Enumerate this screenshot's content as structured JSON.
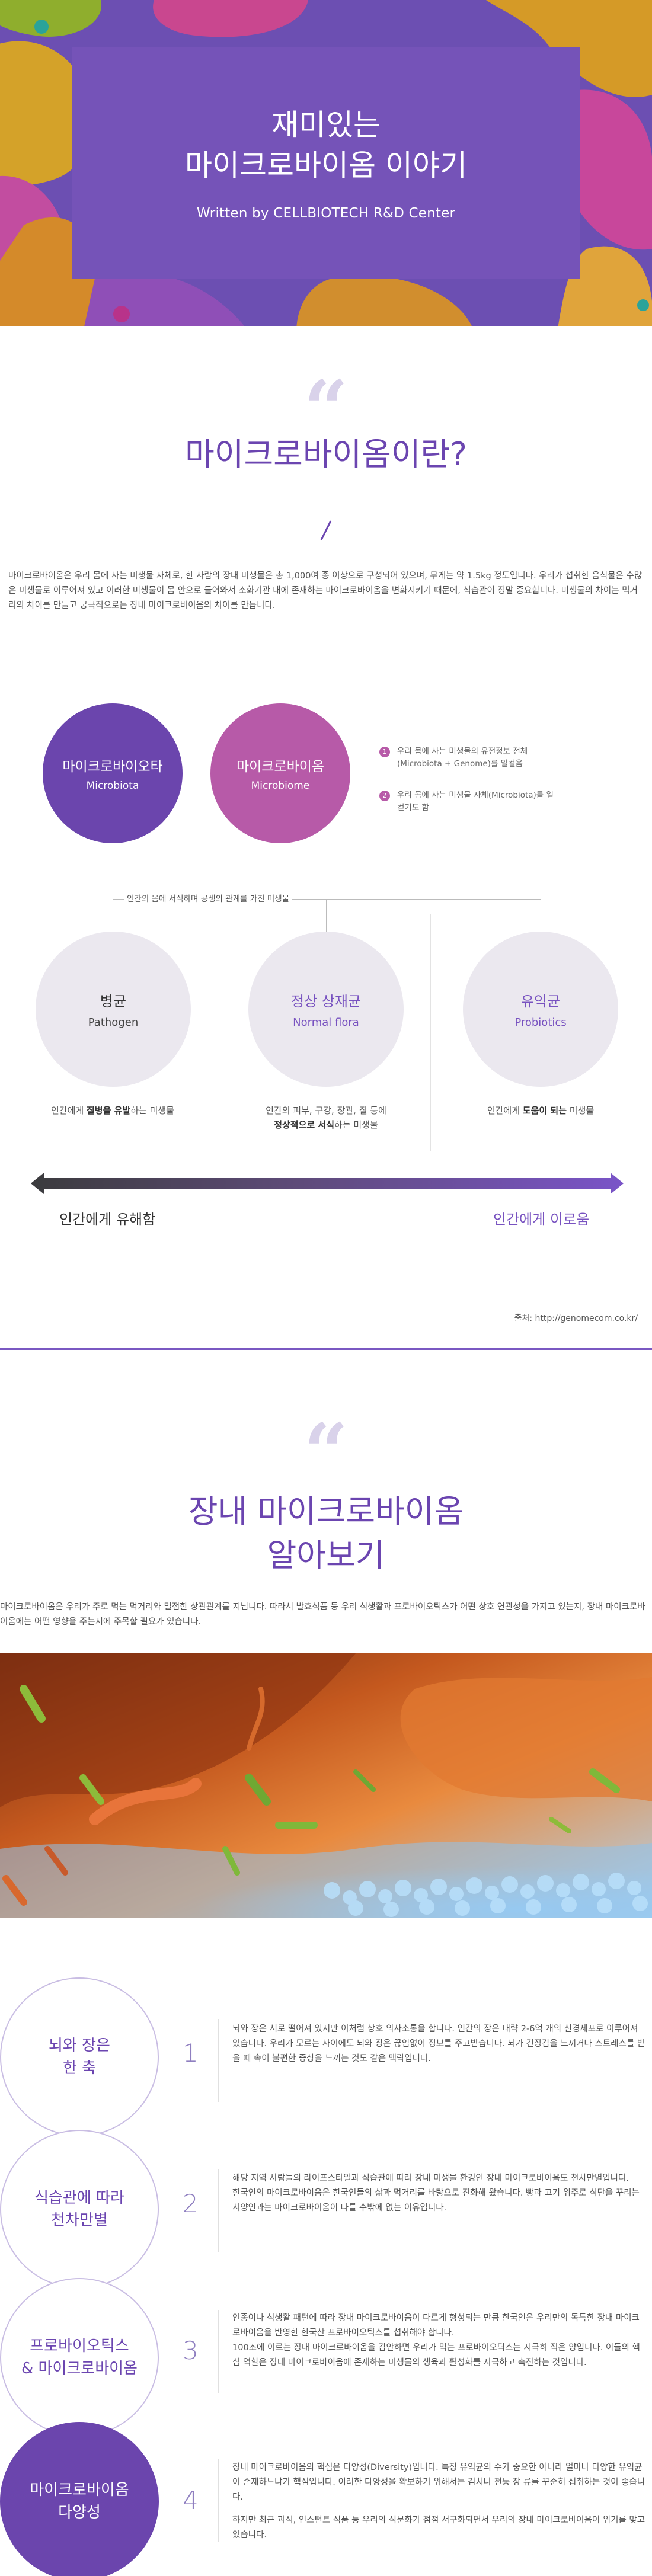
{
  "hero": {
    "title_line1": "재미있는",
    "title_line2": "마이크로바이옴 이야기",
    "subtitle": "Written by CELLBIOTECH R&D Center"
  },
  "section1": {
    "quote_mark": "“",
    "title": "마이크로바이옴이란?",
    "paragraph": "마이크로바이옴은 우리 몸에 사는 미생물 자체로, 한 사람의 장내 미생물은 총 1,000여 종 이상으로 구성되어 있으며, 무게는 약 1.5kg 정도입니다. 우리가 섭취한 음식물은 수많은 미생물로 이루어져 있고 이러한 미생물이 몸 안으로 들어와서 소화기관 내에 존재하는 마이크로바이옴을 변화시키기 때문에, 식습관이 정말 중요합니다. 미생물의 차이는 먹거리의 차이를 만들고 궁극적으로는 장내 마이크로바이옴의 차이를 만듭니다."
  },
  "diagram": {
    "microbiota": {
      "kr": "마이크로바이오타",
      "en": "Microbiota"
    },
    "microbiome": {
      "kr": "마이크로바이옴",
      "en": "Microbiome"
    },
    "notes": [
      {
        "num": "1",
        "text": "우리 몸에 사는 미생물의 유전정보 전체 (Microbiota + Genome)를 일컬음"
      },
      {
        "num": "2",
        "text": "우리 몸에 사는 미생물 자체(Microbiota)를 일컫기도 함"
      }
    ],
    "branch_label": "인간의 몸에 서식하며 공생의 관계를 가진 미생물",
    "pathogen": {
      "kr": "병균",
      "en": "Pathogen"
    },
    "normal": {
      "kr": "정상 상재균",
      "en": "Normal flora"
    },
    "probiotics": {
      "kr": "유익균",
      "en": "Probiotics"
    },
    "cap_pathogen_pre": "인간에게 ",
    "cap_pathogen_bold": "질병을 유발",
    "cap_pathogen_post": "하는 미생물",
    "cap_normal_line1": "인간의 피부, 구강, 장관, 질 등에",
    "cap_normal_bold": "정상적으로 서식",
    "cap_normal_post": "하는 미생물",
    "cap_pro_pre": "인간에게 ",
    "cap_pro_bold": "도움이 되는",
    "cap_pro_post": " 미생물",
    "left_label": "인간에게 유해함",
    "right_label": "인간에게 이로움",
    "source": "출처: http://genomecom.co.kr/",
    "colors": {
      "dark": "#3a3a3a",
      "purple": "#7852c0"
    }
  },
  "section2": {
    "quote_mark": "“",
    "title_line1": "장내 마이크로바이옴",
    "title_line2": "알아보기",
    "paragraph": "마이크로바이옴은 우리가 주로 먹는 먹거리와 밀접한 상관관계를 지닙니다. 따라서 발효식품 등 우리 식생활과 프로바이오틱스가 어떤 상호 연관성을 가지고 있는지, 장내 마이크로바이옴에는 어떤 영향을 주는지에 주목할 필요가 있습니다."
  },
  "items": [
    {
      "label_line1": "뇌와 장은",
      "label_line2": "한 축",
      "num": "1",
      "text": "뇌와 장은 서로 떨어져 있지만 이처럼 상호 의사소통을 합니다. 인간의 장은 대략 2-6억 개의 신경세포로 이루어져 있습니다. 우리가 모르는 사이에도 뇌와 장은 끊임없이 정보를 주고받습니다. 뇌가 긴장감을 느끼거나 스트레스를 받을 때 속이 불편한 증상을 느끼는 것도 같은 맥락입니다."
    },
    {
      "label_line1": "식습관에 따라",
      "label_line2": "천차만별",
      "num": "2",
      "text": "해당 지역 사람들의 라이프스타일과 식습관에 따라 장내 미생물 환경인 장내 마이크로바이옴도 천차만별입니다.",
      "text2": "한국인의 마이크로바이옴은 한국인들의 삶과 먹거리를 바탕으로 진화해 왔습니다. 빵과 고기 위주로 식단을 꾸리는 서양인과는 마이크로바이옴이 다를 수밖에 없는 이유입니다."
    },
    {
      "label_line1": "프로바이오틱스",
      "label_line2": "& 마이크로바이옴",
      "num": "3",
      "text": "인종이나 식생활 패턴에 따라 장내 마이크로바이옴이 다르게 형성되는 만큼 한국인은 우리만의 독특한 장내 마이크로바이옴을 반영한 한국산 프로바이오틱스를 섭취해야 합니다.",
      "text2": "100조에 이르는 장내 마이크로바이옴을 감안하면 우리가 먹는 프로바이오틱스는 지극히 적은 양입니다. 이들의 핵심 역할은 장내 마이크로바이옴에 존재하는 미생물의 생육과 활성화를 자극하고 촉진하는 것입니다."
    },
    {
      "label_line1": "마이크로바이옴",
      "label_line2": "다양성",
      "num": "4",
      "text": "장내 마이크로바이옴의 핵심은 다양성(Diversity)입니다. 특정 유익균의 수가 중요한 아니라 얼마나 다양한 유익균이 존재하느냐가 핵심입니다. 이러한 다양성을 확보하기 위해서는 김치나 전통 장 류를 꾸준히 섭취하는 것이 좋습니다.",
      "text2": "하지만 최근 과식, 인스턴트 식품 등 우리의 식문화가 점점 서구화되면서 우리의 장내 마이크로바이옴이 위기를 맞고 있습니다."
    }
  ]
}
